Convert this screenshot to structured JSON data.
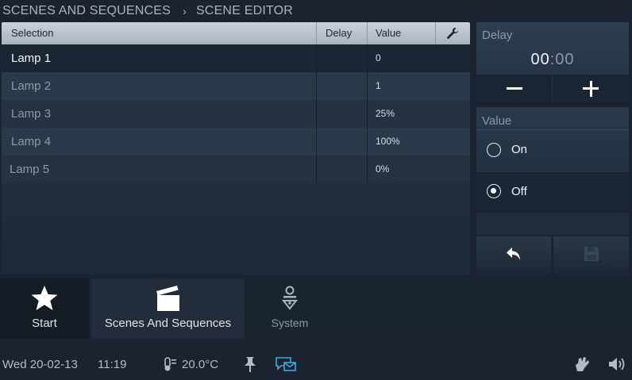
{
  "breadcrumb": {
    "parent": "SCENES AND SEQUENCES",
    "separator": "›",
    "current": "SCENE EDITOR"
  },
  "table": {
    "columns": [
      "Selection",
      "Delay",
      "Value"
    ],
    "settings_icon": "wrench-icon",
    "rows": [
      {
        "name": "Lamp 1",
        "delay": "",
        "value": "0",
        "selected": true
      },
      {
        "name": "Lamp 2",
        "delay": "",
        "value": "1",
        "selected": false
      },
      {
        "name": "Lamp 3",
        "delay": "",
        "value": "25%",
        "selected": false
      },
      {
        "name": "Lamp 4",
        "delay": "",
        "value": "100%",
        "selected": false
      },
      {
        "name": "Lamp 5",
        "delay": "",
        "value": "0%",
        "selected": false
      }
    ]
  },
  "delay_panel": {
    "title": "Delay",
    "minutes": "00",
    "separator": ":",
    "seconds": "00",
    "decrement_icon": "minus-icon",
    "increment_icon": "plus-icon"
  },
  "value_panel": {
    "title": "Value",
    "options": [
      {
        "label": "On",
        "checked": false
      },
      {
        "label": "Off",
        "checked": true
      }
    ]
  },
  "actions": {
    "back_icon": "undo-arrow-icon",
    "save_icon": "floppy-disk-icon",
    "save_enabled": false
  },
  "nav": {
    "items": [
      {
        "label": "Start",
        "icon": "star-icon",
        "active": false
      },
      {
        "label": "Scenes And Sequences",
        "icon": "clapperboard-icon",
        "active": true
      },
      {
        "label": "System",
        "icon": "system-icon",
        "active": false
      }
    ]
  },
  "status_bar": {
    "date": "Wed 20-02-13",
    "time": "11:19",
    "temperature": "20.0°C",
    "icons": [
      "thermometer-icon",
      "pin-icon",
      "message-icon",
      "hand-icon",
      "speaker-icon"
    ]
  },
  "colors": {
    "background": "#1c2330",
    "header": "#b9c3ce",
    "accent": "#3fa9e0",
    "text": "#e6ebf0",
    "muted": "#8d99a6"
  }
}
